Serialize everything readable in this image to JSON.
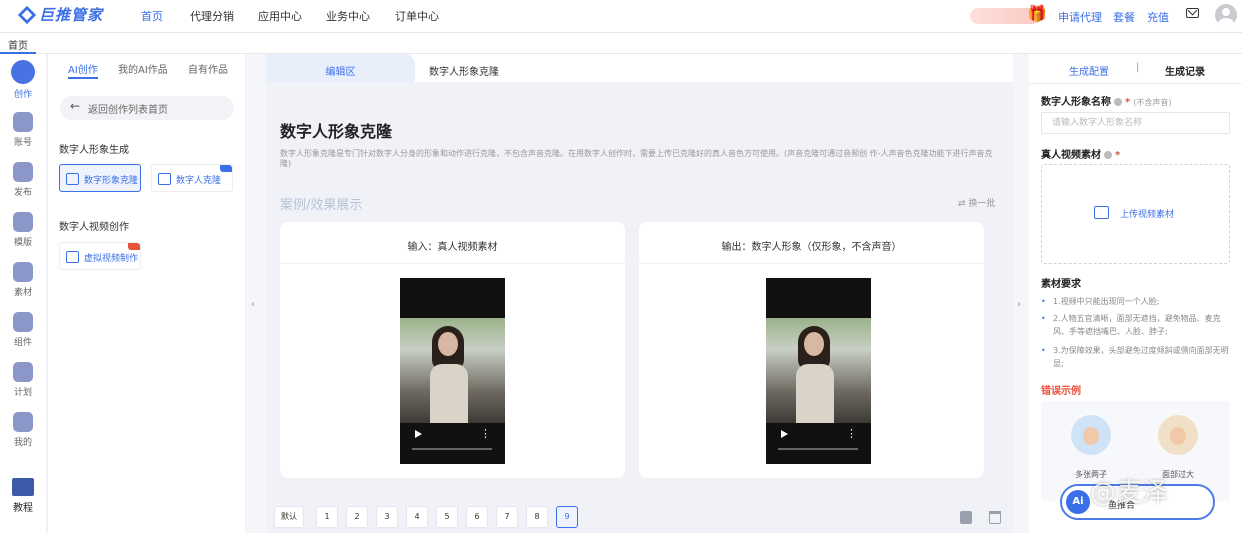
{
  "topnav": {
    "logo": "巨推管家",
    "items": [
      "首页",
      "代理分销",
      "应用中心",
      "业务中心",
      "订单中心"
    ],
    "links": [
      "申请代理",
      "套餐",
      "充值"
    ]
  },
  "tabstrip": {
    "home": "首页"
  },
  "iconbar": {
    "items": [
      {
        "label": "创作",
        "icon": "create-icon"
      },
      {
        "label": "账号",
        "icon": "account-icon"
      },
      {
        "label": "发布",
        "icon": "publish-icon"
      },
      {
        "label": "模版",
        "icon": "template-icon"
      },
      {
        "label": "素材",
        "icon": "material-icon"
      },
      {
        "label": "组件",
        "icon": "component-icon"
      },
      {
        "label": "计划",
        "icon": "plan-icon"
      },
      {
        "label": "我的",
        "icon": "user-icon"
      },
      {
        "label": "教程",
        "icon": "tutorial-icon"
      }
    ]
  },
  "createpanel": {
    "tabs": [
      "AI创作",
      "我的AI作品",
      "自有作品"
    ],
    "back": "返回创作列表首页",
    "sections": [
      "数字人形象生成",
      "数字人视频创作"
    ],
    "cards": [
      "数字形象克隆",
      "数字人克隆",
      "虚拟视频制作"
    ]
  },
  "center": {
    "tabs": [
      "编辑区",
      "数字人形象克隆"
    ],
    "title": "数字人形象克隆",
    "description": "数字人形象克隆是专门针对数字人分身的形象和动作进行克隆，不包含声音克隆。在用数字人创作时，需要上传已克隆好的真人音色方可使用。(声音克隆可通过音频创 作-人声音色克隆功能下进行声音克隆)",
    "showcase": "案例/效果展示",
    "swap": "换一批",
    "previews": [
      {
        "label": "输入：真人视频素材"
      },
      {
        "label": "输出：数字人形象（仅形象，不含声音）"
      }
    ],
    "pagination": {
      "default": "默认",
      "pages": [
        "1",
        "2",
        "3",
        "4",
        "5",
        "6",
        "7",
        "8",
        "9"
      ],
      "active": "9"
    }
  },
  "rightpanel": {
    "tabs": [
      "生成配置",
      "|",
      "生成记录"
    ],
    "name_label": "数字人形象名称",
    "name_hint": "(不含声音)",
    "name_placeholder": "请输入数字人形象名称",
    "name_value": "",
    "video_label": "真人视频素材",
    "upload": "上传视频素材",
    "req_title": "素材要求",
    "requirements": [
      "1.视频中只能出现同一个人脸;",
      "2.人物五官清晰，面部无遮挡，避免物品、麦克风、手等遮挡嘴巴、人脸、脖子;",
      "3.为保障效果，头部避免过度倾斜或侧向面部无明显;"
    ],
    "error_title": "错误示例",
    "error_examples": [
      "多张两子",
      "面部过大"
    ]
  },
  "ai_widget": {
    "icon": "Ai",
    "text": "鱼推合"
  },
  "watermark": "@麦泽",
  "colors": {
    "accent": "#3b6fe8",
    "error": "#e8533f"
  }
}
